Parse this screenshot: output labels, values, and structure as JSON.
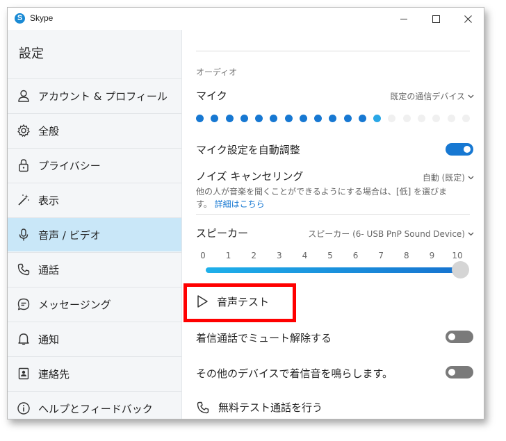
{
  "window": {
    "title": "Skype",
    "logo_letter": "S"
  },
  "sidebar": {
    "title": "設定",
    "items": [
      {
        "label": "アカウント & プロフィール",
        "icon": "person-icon"
      },
      {
        "label": "全般",
        "icon": "gear-icon"
      },
      {
        "label": "プライバシー",
        "icon": "lock-icon"
      },
      {
        "label": "表示",
        "icon": "magic-wand-icon"
      },
      {
        "label": "音声 / ビデオ",
        "icon": "microphone-icon",
        "active": true
      },
      {
        "label": "通話",
        "icon": "phone-icon"
      },
      {
        "label": "メッセージング",
        "icon": "chat-bubble-icon"
      },
      {
        "label": "通知",
        "icon": "bell-icon"
      },
      {
        "label": "連絡先",
        "icon": "contact-card-icon"
      },
      {
        "label": "ヘルプとフィードバック",
        "icon": "info-icon"
      }
    ]
  },
  "audio": {
    "section_label": "オーディオ",
    "mic": {
      "label": "マイク",
      "device": "既定の通信デバイス",
      "level_dots_total": 19,
      "level_dots_on": 13
    },
    "auto_adjust": {
      "label": "マイク設定を自動調整",
      "state": "on"
    },
    "noise_cancel": {
      "label": "ノイズ キャンセリング",
      "value": "自動 (既定)",
      "description": "他の人が音楽を聞くことができるようにする場合は、[低] を選びます。",
      "link": "詳細はこちら"
    },
    "speaker": {
      "label": "スピーカー",
      "device": "スピーカー (6- USB PnP Sound Device)",
      "ticks": [
        "0",
        "1",
        "2",
        "3",
        "4",
        "5",
        "6",
        "7",
        "8",
        "9",
        "10"
      ],
      "volume": 10
    },
    "test_button": "音声テスト",
    "unmute_incoming": {
      "label": "着信通話でミュート解除する",
      "state": "off"
    },
    "ring_other_devices": {
      "label": "その他のデバイスで着信音を鳴らします。",
      "state": "off"
    },
    "free_test_call": "無料テスト通話を行う"
  },
  "colors": {
    "accent": "#1778d2",
    "sidebar_bg": "#f4f6f8",
    "active_item_bg": "#c9e7f8",
    "highlight_box": "#ff0000"
  }
}
